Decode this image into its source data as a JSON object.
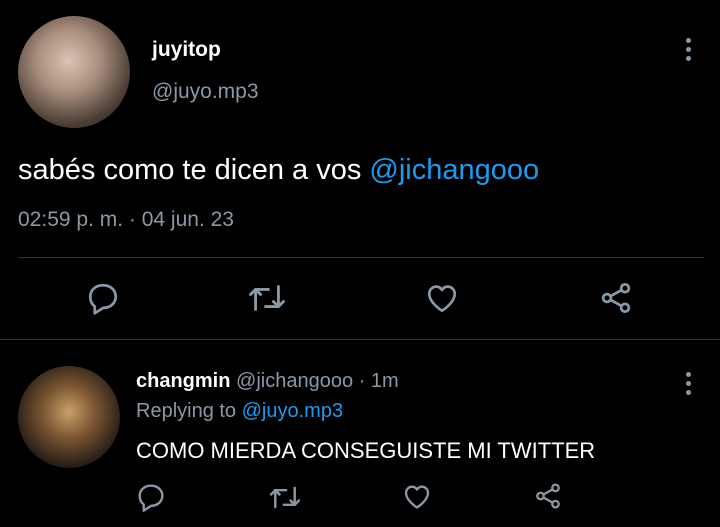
{
  "main_tweet": {
    "display_name": "juyitop",
    "handle": "@juyo.mp3",
    "text_prefix": "sabés como te dicen a vos ",
    "mention": "@jichangooo",
    "timestamp": "02:59 p. m. · 04 jun. 23"
  },
  "reply_tweet": {
    "display_name": "changmin",
    "handle": "@jichangooo",
    "time": " · 1m",
    "replying_to_label": "Replying to ",
    "replying_to_handle": "@juyo.mp3",
    "text": "COMO MIERDA CONSEGUISTE MI TWITTER"
  },
  "icons": {
    "reply": "reply-icon",
    "retweet": "retweet-icon",
    "like": "like-icon",
    "share": "share-icon",
    "more": "more-icon"
  },
  "colors": {
    "background": "#000000",
    "text": "#ffffff",
    "muted": "#8b98a5",
    "accent": "#1d9bf0",
    "divider": "#2f3336"
  }
}
